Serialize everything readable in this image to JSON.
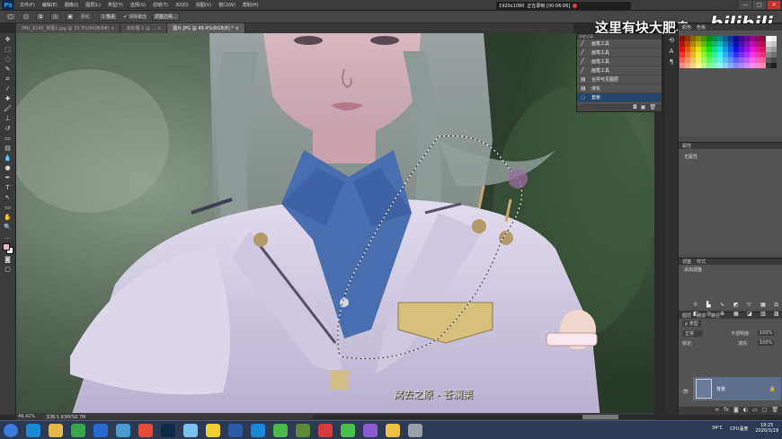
{
  "menubar": {
    "logo": "Ps",
    "items": [
      "文件(F)",
      "编辑(E)",
      "图像(I)",
      "图层(L)",
      "类型(Y)",
      "选择(S)",
      "滤镜(T)",
      "3D(D)",
      "视图(V)",
      "窗口(W)",
      "帮助(H)"
    ]
  },
  "recorder": {
    "resolution": "1920x1080",
    "status": "正在录制 [00:06:06]"
  },
  "window_controls": {
    "minimize": "—",
    "restore": "□",
    "close": "✕"
  },
  "options_bar": {
    "mode_label": "羽化：",
    "feather_value": "1 像素",
    "antialias": "消除锯齿",
    "refine_button": "调整边缘..."
  },
  "document_tabs": [
    {
      "label": "IMG_9145_新图1.jpg @ 33.3%(RGB/8#) ×",
      "active": false
    },
    {
      "label": "未标题-1 @ ... ×",
      "active": false
    },
    {
      "label": "图片.JPG @ 49.4%(RGB/8) * ×",
      "active": true
    }
  ],
  "watermark": {
    "text": "这里有块大肥皂",
    "brand": "bilibili"
  },
  "subtitle": "窝去之原 - 苍澜栗",
  "statusbar": {
    "zoom": "49.42%",
    "doc_info": "文档:5.93M/58.7M"
  },
  "history": {
    "header": "历史记录",
    "items": [
      {
        "label": "画笔工具",
        "selected": false
      },
      {
        "label": "画笔工具",
        "selected": false
      },
      {
        "label": "画笔工具",
        "selected": false
      },
      {
        "label": "画笔工具",
        "selected": false
      },
      {
        "label": "合并可见图层",
        "selected": false
      },
      {
        "label": "液化",
        "selected": false
      },
      {
        "label": "套索",
        "selected": true
      }
    ]
  },
  "panels": {
    "properties_title": "属性",
    "properties_body": "无属性",
    "adjust_tabs": [
      "调整",
      "样式"
    ],
    "adjust_header": "添加调整",
    "layers_tabs": [
      "图层",
      "通道",
      "路径"
    ],
    "kind_label": "ρ 类型",
    "blend_mode": "正常",
    "opacity_label": "不透明度:",
    "opacity_value": "100%",
    "lock_label": "锁定:",
    "fill_label": "填充:",
    "fill_value": "100%",
    "layer_name": "背景"
  },
  "taskbar": {
    "icons": [
      "start",
      "ie",
      "explorer",
      "360",
      "media",
      "drive",
      "chrome",
      "ps",
      "cloud",
      "qq",
      "word",
      "k",
      "wechat",
      "game",
      "rec",
      "green",
      "app",
      "folder",
      "tool"
    ],
    "tray_temp": "34°C",
    "tray_cpu": "CPU温度",
    "time": "19:25",
    "date": "2020/3/19"
  },
  "colors": {
    "ps_dark": "#3c3c3c",
    "ps_panel": "#535353",
    "selection": "#24466c",
    "taskbar": "#2b3a52"
  }
}
